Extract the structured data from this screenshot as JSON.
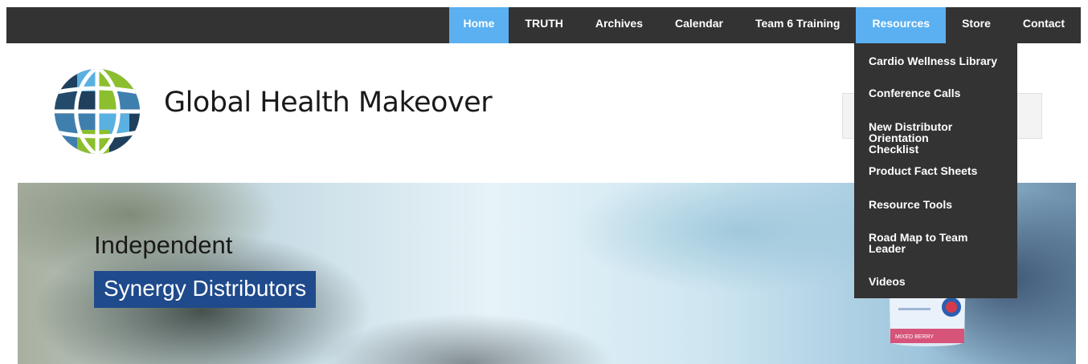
{
  "nav": {
    "items": [
      {
        "label": "Home",
        "active": true
      },
      {
        "label": "TRUTH",
        "active": false
      },
      {
        "label": "Archives",
        "active": false
      },
      {
        "label": "Calendar",
        "active": false
      },
      {
        "label": "Team 6 Training",
        "active": false
      },
      {
        "label": "Resources",
        "active": true
      },
      {
        "label": "Store",
        "active": false
      },
      {
        "label": "Contact",
        "active": false
      }
    ]
  },
  "header": {
    "title": "Global Health Makeover",
    "logo_icon": "globe-logo-icon"
  },
  "hero": {
    "line1": "Independent",
    "line2": "Synergy Distributors",
    "product_label": "MIXED BERRY"
  },
  "resources_menu": {
    "items": [
      "Cardio Wellness Library",
      "Conference Calls",
      "New Distributor Orientation Checklist",
      "Product Fact Sheets",
      "Resource Tools",
      "Road Map to Team Leader",
      "Videos"
    ]
  },
  "colors": {
    "nav_bg": "#333333",
    "active_tab": "#5ab0f0",
    "hero_badge": "#1f4a8c"
  }
}
